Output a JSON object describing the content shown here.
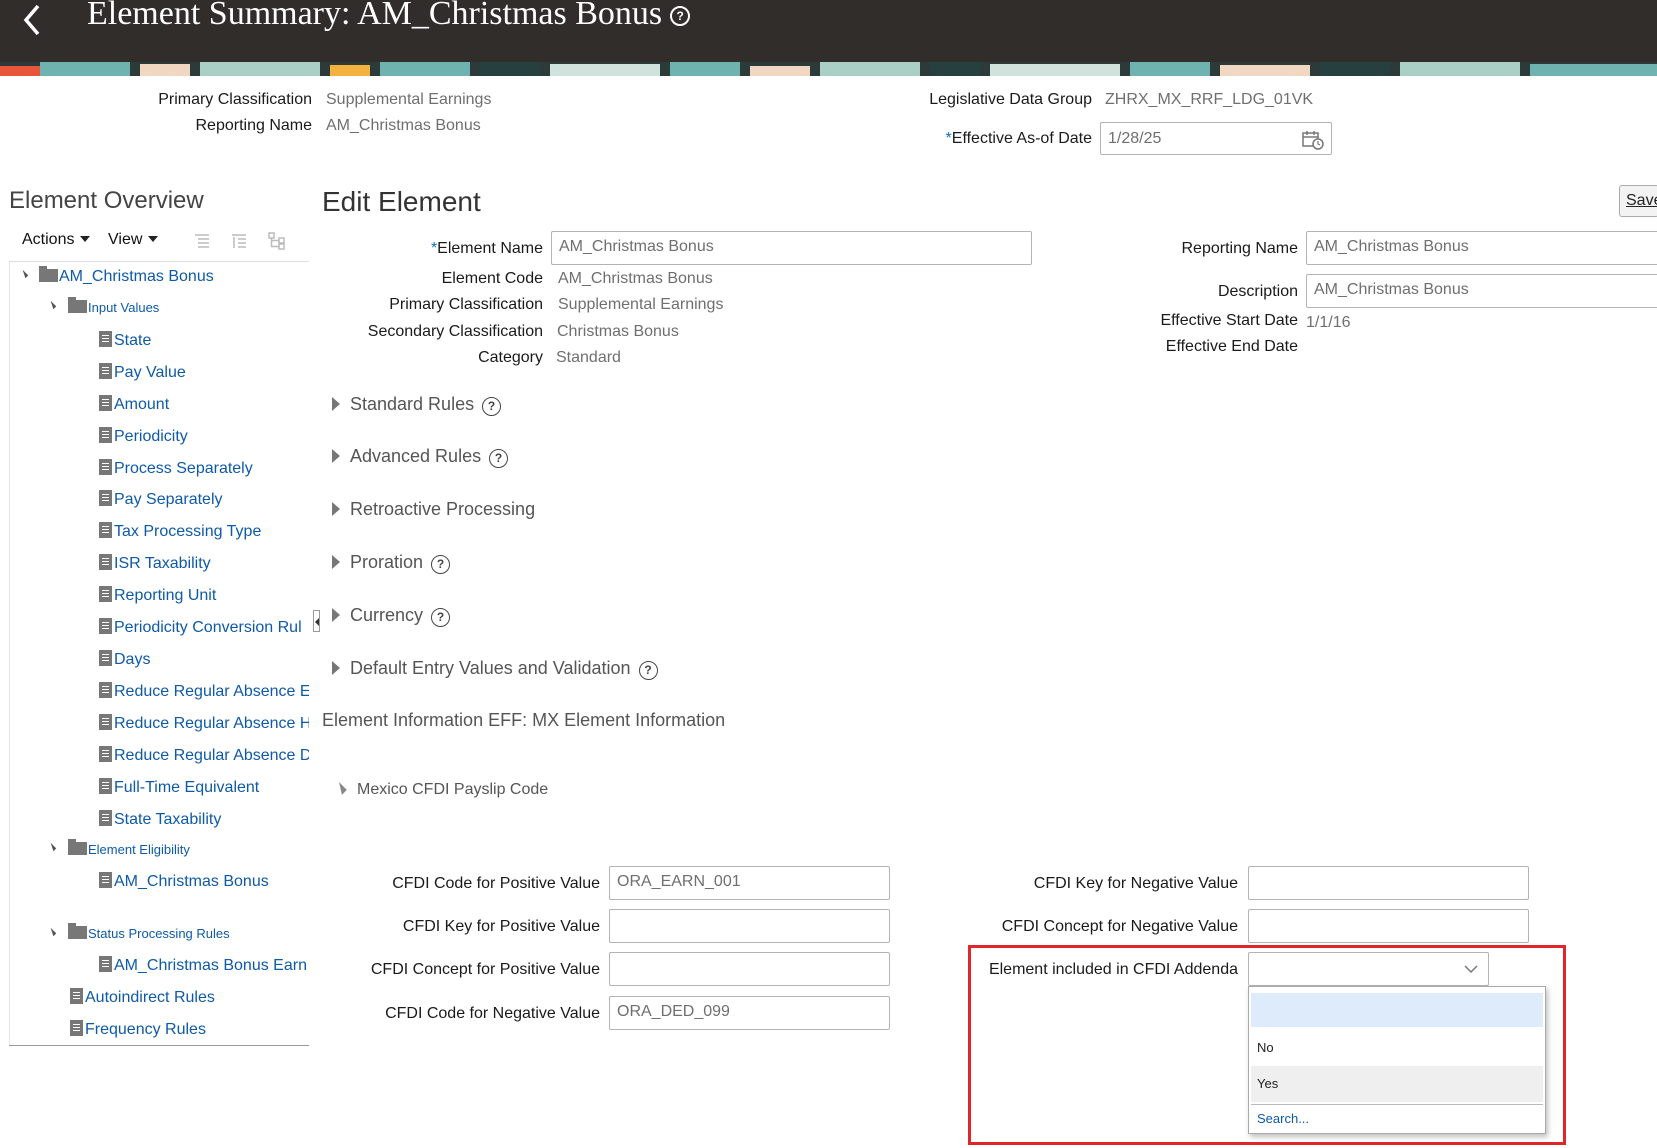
{
  "header": {
    "title": "Element Summary: AM_Christmas Bonus"
  },
  "summary": {
    "primary_classification_label": "Primary Classification",
    "primary_classification_value": "Supplemental Earnings",
    "reporting_name_label": "Reporting Name",
    "reporting_name_value": "AM_Christmas Bonus",
    "ldg_label": "Legislative Data Group",
    "ldg_value": "ZHRX_MX_RRF_LDG_01VK",
    "effective_label": "Effective As-of Date",
    "effective_value": "1/28/25"
  },
  "overview": {
    "title": "Element Overview",
    "actions_label": "Actions",
    "view_label": "View",
    "tree": {
      "root": "AM_Christmas Bonus",
      "input_values": "Input Values",
      "input_items": [
        "State",
        "Pay Value",
        "Amount",
        "Periodicity",
        "Process Separately",
        "Pay Separately",
        "Tax Processing Type",
        "ISR Taxability",
        "Reporting Unit",
        "Periodicity Conversion Rul",
        "Days",
        "Reduce Regular Absence E",
        "Reduce Regular Absence H",
        "Reduce Regular Absence D",
        "Full-Time Equivalent",
        "State Taxability"
      ],
      "element_eligibility": "Element Eligibility",
      "eligibility_item": "AM_Christmas Bonus",
      "status_rules": "Status Processing Rules",
      "status_item": "AM_Christmas Bonus Earn",
      "autoindirect": "Autoindirect Rules",
      "frequency": "Frequency Rules"
    }
  },
  "edit": {
    "title": "Edit Element",
    "save_label": "Save",
    "element_name_label": "Element Name",
    "element_name_value": "AM_Christmas Bonus",
    "element_code_label": "Element Code",
    "element_code_value": "AM_Christmas Bonus",
    "primary_label": "Primary Classification",
    "primary_value": "Supplemental Earnings",
    "secondary_label": "Secondary Classification",
    "secondary_value": "Christmas Bonus",
    "category_label": "Category",
    "category_value": "Standard",
    "reporting_name_label": "Reporting Name",
    "reporting_name_value": "AM_Christmas Bonus",
    "description_label": "Description",
    "description_value": "AM_Christmas Bonus",
    "start_label": "Effective Start Date",
    "start_value": "1/1/16",
    "end_label": "Effective End Date",
    "sections": [
      "Standard Rules",
      "Advanced Rules",
      "Retroactive Processing",
      "Proration",
      "Currency",
      "Default Entry Values and Validation"
    ],
    "eff_title": "Element Information EFF: MX Element Information",
    "cfdi_section": "Mexico CFDI Payslip Code"
  },
  "cfdi": {
    "code_pos_label": "CFDI Code for Positive Value",
    "code_pos_value": "ORA_EARN_001",
    "key_pos_label": "CFDI Key for Positive Value",
    "key_pos_value": "",
    "concept_pos_label": "CFDI Concept for Positive Value",
    "concept_pos_value": "",
    "code_neg_label": "CFDI Code for Negative Value",
    "code_neg_value": "ORA_DED_099",
    "key_neg_label": "CFDI Key for Negative Value",
    "key_neg_value": "",
    "concept_neg_label": "CFDI Concept for Negative Value",
    "concept_neg_value": "",
    "addenda_label": "Element included in CFDI Addenda",
    "addenda_options": [
      "",
      "No",
      "Yes"
    ],
    "search_label": "Search..."
  },
  "colors": {
    "header_bg": "#312d2a",
    "link": "#0e5aa7",
    "required": "#0572ce",
    "highlight_border": "#e0262b"
  }
}
